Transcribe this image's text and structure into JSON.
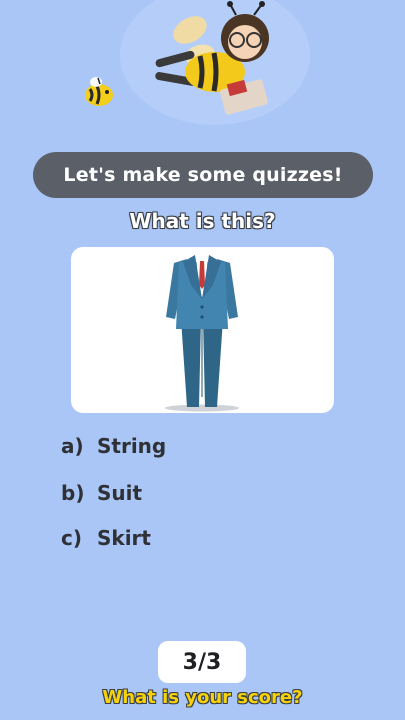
{
  "banner": {
    "title": "Let's make some quizzes!"
  },
  "quiz": {
    "question": "What is this?",
    "image": "suit-illustration",
    "options": [
      {
        "letter": "a)",
        "text": "String"
      },
      {
        "letter": "b)",
        "text": "Suit"
      },
      {
        "letter": "c)",
        "text": "Skirt"
      }
    ]
  },
  "score": {
    "value": "3/3",
    "prompt": "What is your score?"
  },
  "colors": {
    "background": "#a9c6f6",
    "banner": "#5b6068",
    "prompt": "#f5d20a"
  }
}
